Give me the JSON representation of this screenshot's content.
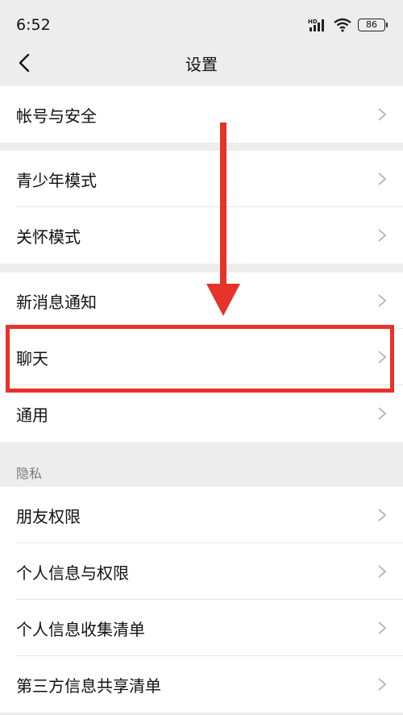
{
  "status_bar": {
    "time": "6:52",
    "signal_label": "HD",
    "battery": "86"
  },
  "nav": {
    "title": "设置"
  },
  "groups": [
    {
      "items": [
        "帐号与安全"
      ]
    },
    {
      "items": [
        "青少年模式",
        "关怀模式"
      ]
    },
    {
      "items": [
        "新消息通知",
        "聊天",
        "通用"
      ]
    },
    {
      "label": "隐私",
      "items": [
        "朋友权限",
        "个人信息与权限",
        "个人信息收集清单",
        "第三方信息共享清单"
      ]
    }
  ],
  "annotation": {
    "highlighted_item": "聊天",
    "color": "#e5332a"
  }
}
